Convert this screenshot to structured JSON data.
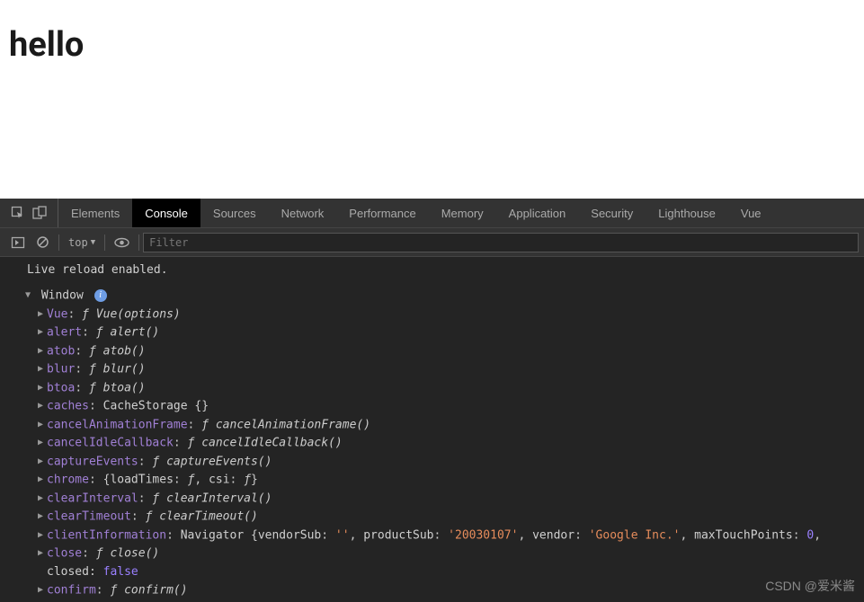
{
  "page": {
    "heading": "hello"
  },
  "devtools": {
    "tabs": [
      "Elements",
      "Console",
      "Sources",
      "Network",
      "Performance",
      "Memory",
      "Application",
      "Security",
      "Lighthouse",
      "Vue"
    ],
    "active_tab": "Console",
    "toolbar": {
      "context": "top",
      "filter_placeholder": "Filter"
    }
  },
  "console": {
    "log": "Live reload enabled.",
    "root": "Window",
    "props": [
      {
        "key": "Vue",
        "type": "fn",
        "sig": "Vue(options)"
      },
      {
        "key": "alert",
        "type": "fn",
        "sig": "alert()"
      },
      {
        "key": "atob",
        "type": "fn",
        "sig": "atob()"
      },
      {
        "key": "blur",
        "type": "fn",
        "sig": "blur()"
      },
      {
        "key": "btoa",
        "type": "fn",
        "sig": "btoa()"
      },
      {
        "key": "caches",
        "type": "plain",
        "value": "CacheStorage {}"
      },
      {
        "key": "cancelAnimationFrame",
        "type": "fn",
        "sig": "cancelAnimationFrame()"
      },
      {
        "key": "cancelIdleCallback",
        "type": "fn",
        "sig": "cancelIdleCallback()"
      },
      {
        "key": "captureEvents",
        "type": "fn",
        "sig": "captureEvents()"
      },
      {
        "key": "chrome",
        "type": "chrome"
      },
      {
        "key": "clearInterval",
        "type": "fn",
        "sig": "clearInterval()"
      },
      {
        "key": "clearTimeout",
        "type": "fn",
        "sig": "clearTimeout()"
      },
      {
        "key": "clientInformation",
        "type": "nav"
      },
      {
        "key": "close",
        "type": "fn",
        "sig": "close()"
      },
      {
        "key": "closed",
        "type": "bool",
        "value": "false",
        "expandable": false
      },
      {
        "key": "confirm",
        "type": "fn",
        "sig": "confirm()"
      }
    ],
    "chrome_inner": {
      "k1": "loadTimes",
      "k2": "csi"
    },
    "nav_inner": {
      "prefix": "Navigator {",
      "k1": "vendorSub",
      "v1": "''",
      "k2": "productSub",
      "v2": "'20030107'",
      "k3": "vendor",
      "v3": "'Google Inc.'",
      "k4": "maxTouchPoints",
      "v4": "0"
    }
  },
  "watermark": "CSDN @爱米酱"
}
